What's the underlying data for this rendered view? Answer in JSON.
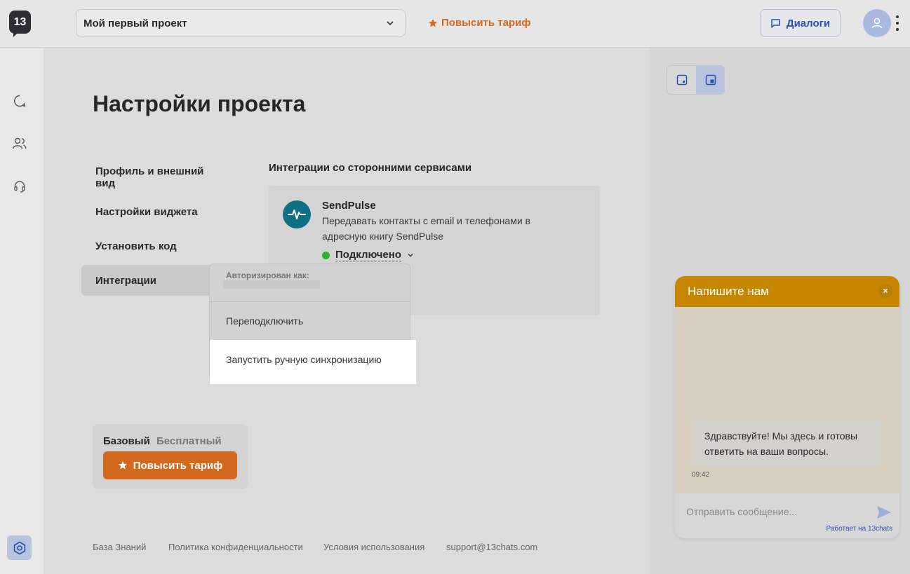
{
  "header": {
    "logo_text": "13",
    "project_name": "Мой первый проект",
    "upgrade_label": "Повысить тариф",
    "dialogs_label": "Диалоги"
  },
  "page": {
    "title": "Настройки проекта"
  },
  "nav": {
    "items": [
      {
        "label": "Профиль и внешний вид"
      },
      {
        "label": "Настройки виджета"
      },
      {
        "label": "Установить код"
      },
      {
        "label": "Интеграции"
      }
    ]
  },
  "integrations": {
    "section_title": "Интеграции со сторонними сервисами",
    "sendpulse": {
      "name": "SendPulse",
      "description": "Передавать контакты с email и телефонами в адресную книгу SendPulse",
      "status": "Подключено"
    }
  },
  "popup": {
    "auth_label": "Авторизирован как:",
    "reconnect": "Переподключить",
    "manual_sync": "Запустить ручную синхронизацию"
  },
  "plan": {
    "current": "Базовый",
    "type": "Бесплатный",
    "upgrade_label": "Повысить тариф"
  },
  "footer": {
    "links": [
      "База Знаний",
      "Политика конфиденциальности",
      "Условия использования",
      "support@13chats.com"
    ]
  },
  "widget": {
    "title": "Напишите нам",
    "close": "×",
    "message": "Здравствуйте! Мы здесь и готовы ответить на ваши вопросы.",
    "time": "09:42",
    "input_placeholder": "Отправить сообщение...",
    "powered_by": "Работает на 13chats"
  },
  "colors": {
    "accent_orange": "#d2691e",
    "accent_blue": "#2a4fb0",
    "widget_header": "#c68600",
    "status_green": "#2db22d"
  }
}
